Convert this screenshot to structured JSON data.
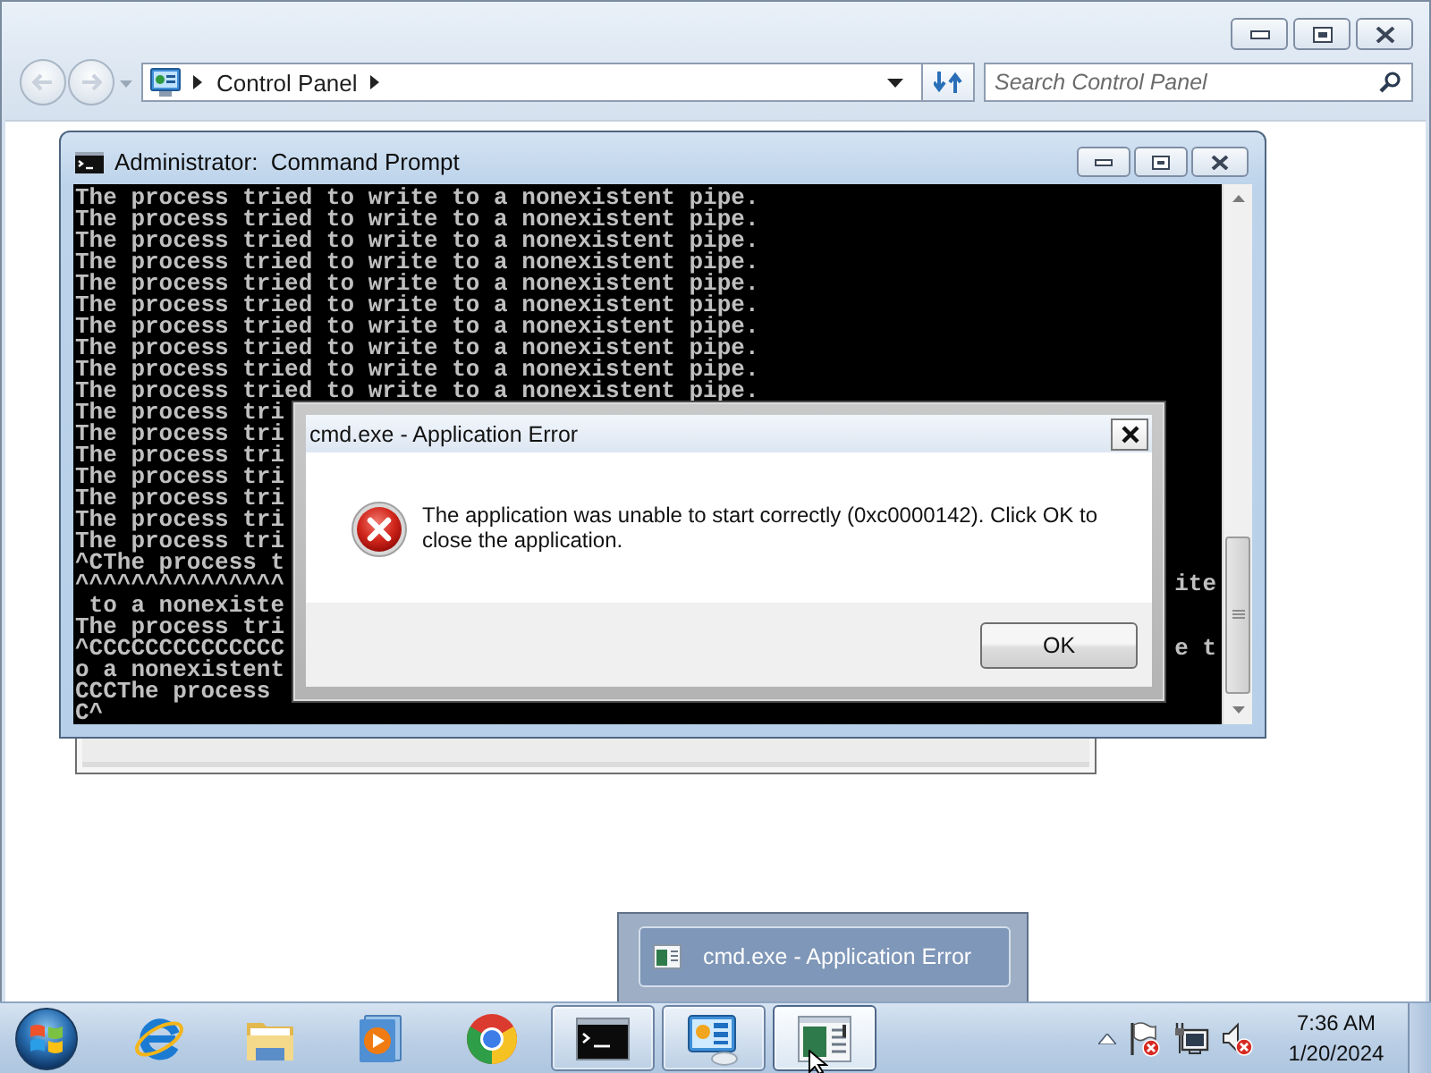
{
  "control_panel": {
    "breadcrumbs": [
      "Control Panel"
    ],
    "search": {
      "placeholder": "Search Control Panel"
    }
  },
  "command_prompt": {
    "title": "Administrator:  Command Prompt",
    "lines": [
      {
        "text": "The process tried to write to a nonexistent pipe."
      },
      {
        "text": "The process tried to write to a nonexistent pipe."
      },
      {
        "text": "The process tried to write to a nonexistent pipe."
      },
      {
        "text": "The process tried to write to a nonexistent pipe."
      },
      {
        "text": "The process tried to write to a nonexistent pipe."
      },
      {
        "text": "The process tried to write to a nonexistent pipe."
      },
      {
        "text": "The process tried to write to a nonexistent pipe."
      },
      {
        "text": "The process tried to write to a nonexistent pipe."
      },
      {
        "text": "The process tried to write to a nonexistent pipe."
      },
      {
        "text": "The process tried to write to a nonexistent pipe."
      },
      {
        "text": "The process tri"
      },
      {
        "text": "The process tri"
      },
      {
        "text": "The process tri"
      },
      {
        "text": "The process tri"
      },
      {
        "text": "The process tri"
      },
      {
        "text": "The process tri"
      },
      {
        "text": "The process tri"
      },
      {
        "text": "^CThe process t"
      },
      {
        "text": "^^^^^^^^^^^^^^^",
        "tail": "ite"
      },
      {
        "text": " to a nonexiste"
      },
      {
        "text": "The process tri"
      },
      {
        "text": "^CCCCCCCCCCCCCC",
        "tail": "e t"
      },
      {
        "text": "o a nonexistent"
      },
      {
        "text": "CCCThe process"
      },
      {
        "text": "C^"
      }
    ]
  },
  "error_dialog": {
    "title": "cmd.exe - Application Error",
    "message": "The application was unable to start correctly (0xc0000142). Click OK to close the application.",
    "buttons": [
      "OK"
    ]
  },
  "taskbar": {
    "preview": {
      "title": "cmd.exe - Application Error"
    },
    "buttons": [
      {
        "running": false,
        "selected": false
      },
      {
        "running": false,
        "selected": false
      },
      {
        "running": false,
        "selected": false
      },
      {
        "running": false,
        "selected": false
      },
      {
        "running": true,
        "selected": false
      },
      {
        "running": true,
        "selected": false
      },
      {
        "running": true,
        "selected": true
      }
    ],
    "tray": [
      {
        "alert": true
      },
      {
        "alert": false
      },
      {
        "alert": true
      }
    ],
    "clock": {
      "time": "7:36 AM",
      "date": "1/20/2024"
    }
  }
}
